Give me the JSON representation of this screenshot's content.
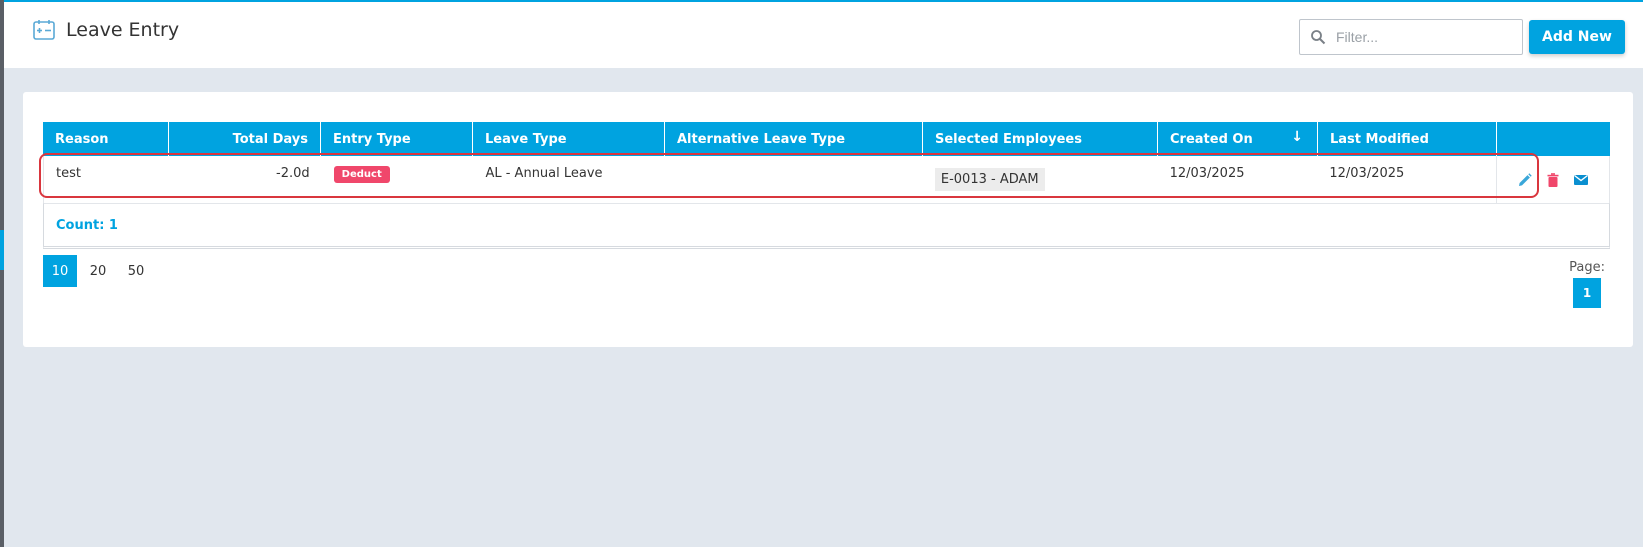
{
  "header": {
    "title": "Leave Entry",
    "filter_placeholder": "Filter...",
    "add_button": "Add New"
  },
  "grid": {
    "columns": [
      "Reason",
      "Total Days",
      "Entry Type",
      "Leave Type",
      "Alternative Leave Type",
      "Selected Employees",
      "Created On",
      "Last Modified"
    ],
    "sort_indicator": "↓",
    "rows": [
      {
        "reason": "test",
        "total_days": "-2.0d",
        "entry_type": "Deduct",
        "leave_type": "AL - Annual Leave",
        "alternative_leave_type": "",
        "selected_employees": "E-0013 - ADAM",
        "created_on": "12/03/2025",
        "last_modified": "12/03/2025"
      }
    ],
    "count_label": "Count: 1"
  },
  "pager": {
    "sizes": [
      "10",
      "20",
      "50"
    ],
    "active_size": "10",
    "page_label": "Page:",
    "current_page": "1"
  },
  "colors": {
    "accent": "#00a3e0",
    "deduct": "#f0476b",
    "highlight": "#d9363e"
  },
  "icons": [
    "calendar-entry-icon",
    "search-icon",
    "edit-icon",
    "delete-icon",
    "email-icon"
  ]
}
